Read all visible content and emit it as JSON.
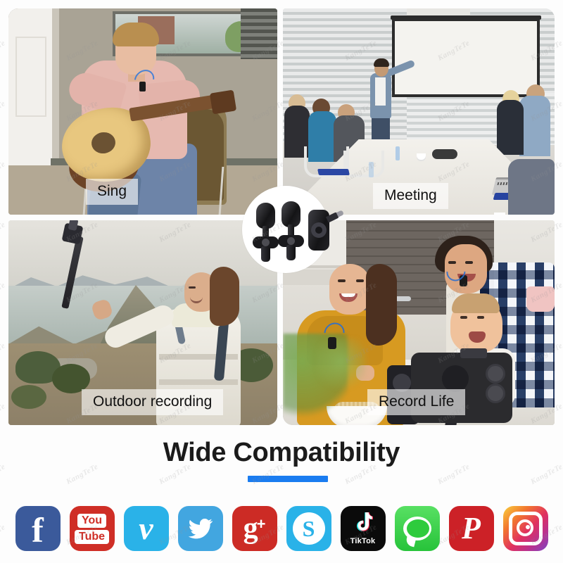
{
  "product": {
    "name": "wireless-lavalier-microphone-set",
    "items": [
      "microphone-1",
      "microphone-2",
      "receiver-lightning"
    ]
  },
  "collage": {
    "panels": [
      {
        "id": "sing",
        "caption": "Sing",
        "scene": "man playing acoustic guitar in a room with window, wearing clip-on lavalier microphone"
      },
      {
        "id": "meeting",
        "caption": "Meeting",
        "scene": "business presenter at projector screen with colleagues around conference table"
      },
      {
        "id": "outdoor-recording",
        "caption": "Outdoor recording",
        "scene": "woman in white puffer jacket recording selfie with selfie stick on coastal mountain"
      },
      {
        "id": "record-life",
        "caption": "Record Life",
        "scene": "family in kitchen recording with smartphone on tripod mount, mother, father and baby"
      }
    ]
  },
  "headline": {
    "title": "Wide Compatibility",
    "accent_color": "#1a7cf0"
  },
  "social_icons": [
    {
      "name": "facebook",
      "label": "f",
      "color": "#3b5a9b"
    },
    {
      "name": "youtube",
      "label": "You",
      "label2": "Tube",
      "color": "#cf2e26"
    },
    {
      "name": "vimeo",
      "label": "v",
      "color": "#2ab2e8"
    },
    {
      "name": "twitter",
      "label": "",
      "color": "#42a6e0"
    },
    {
      "name": "google-plus",
      "label": "g",
      "label2": "+",
      "color": "#cc2b25"
    },
    {
      "name": "skype",
      "label": "S",
      "color": "#2ab2e8"
    },
    {
      "name": "tiktok",
      "label": "TikTok",
      "color": "#0b0b0b"
    },
    {
      "name": "messages",
      "label": "",
      "color": "#2ecb3d"
    },
    {
      "name": "pinterest",
      "label": "P",
      "color": "#cc2127"
    },
    {
      "name": "instagram",
      "label": "",
      "color": "#e0315f"
    }
  ],
  "watermark": {
    "text": "KangTeTe"
  }
}
